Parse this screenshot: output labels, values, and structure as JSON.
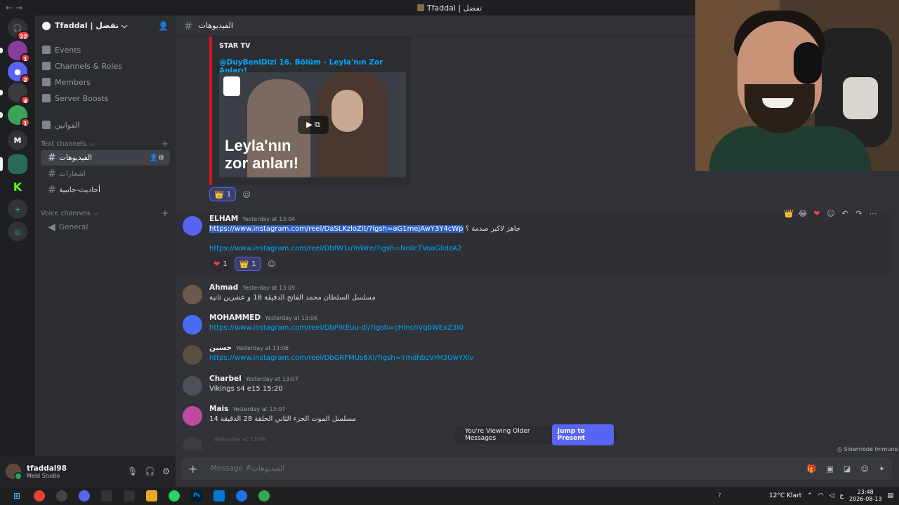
{
  "window": {
    "title": "Tfaddal | تفضل",
    "nav": "← →"
  },
  "server": {
    "name": "Tfaddal | تفضل ⌵",
    "menu": [
      "Events",
      "Channels & Roles",
      "Members",
      "Server Boosts",
      "القوانين"
    ],
    "text_category": "Text channels",
    "text_channels": [
      "الفيديوهات",
      "اشعارات",
      "أحاديث-جانبية"
    ],
    "voice_category": "Voice channels",
    "voice_channels": [
      "General"
    ]
  },
  "server_rail": {
    "badges": [
      "22",
      "1",
      "2",
      "4",
      "1"
    ],
    "letter": "M"
  },
  "header": {
    "channel": "الفيديوهات"
  },
  "embed": {
    "provider": "STAR TV",
    "title": "@DuyBeniDizi 16. Bölüm - Leyla'nın Zor Anları!",
    "caption_line1": "Leyla'nın",
    "caption_line2": "zor anları!",
    "reactions": [
      {
        "emoji": "👑",
        "count": "1"
      }
    ]
  },
  "messages": [
    {
      "author": "ELHAM",
      "time": "Yesterday at 13:04",
      "link1": "https://www.instagram.com/reel/DaSLKzloZit/?igsh=aG1mejAwY3Y4cWp",
      "text1": "جاهز لاكبر صدمة ؟",
      "link2": "https://www.instagram.com/reel/DbfW1uYoWre/?igsh=NnlicTVoaGlidzA2",
      "reactions": [
        {
          "emoji": "❤",
          "count": "1"
        },
        {
          "emoji": "👑",
          "count": "1"
        }
      ],
      "avatar_color": "#5865f2"
    },
    {
      "author": "Ahmad",
      "time": "Yesterday at 13:05",
      "text": "مسلسل السلطان محمد الفاتح الدقيقة 18 و عشرين ثانية",
      "avatar_color": "#6b5a4a"
    },
    {
      "author": "MOHAMMED",
      "time": "Yesterday at 13:06",
      "link": "https://www.instagram.com/reel/DbP9tEuu-dl/?igsh=cHlncnVqbWExZ3I0",
      "avatar_color": "#4a6cf2"
    },
    {
      "author": "حسين",
      "time": "Yesterday at 13:06",
      "link": "https://www.instagram.com/reel/DbGRFMUs6XI/?igsh=YmdhbzVrM3UwYXlv",
      "avatar_color": "#5a5040"
    },
    {
      "author": "Charbel",
      "time": "Yesterday at 13:07",
      "text": "Vikings s4 e15 15:20",
      "avatar_color": "#4e5058"
    },
    {
      "author": "Mais",
      "time": "Yesterday at 13:07",
      "text": "مسلسل الموت الجزء الثاني الحلقة 28 الدقيقة 14",
      "avatar_color": "#c04aa0"
    },
    {
      "author": "",
      "time": "Yesterday at 13:09",
      "avatar_color": "#4e5058"
    }
  ],
  "toolbar_icons": [
    "crown-icon",
    "laugh-icon",
    "heart-icon",
    "add-reaction-icon",
    "reply-icon",
    "forward-icon",
    "more-icon"
  ],
  "older_banner": {
    "text": "You're Viewing Older Messages",
    "button": "Jump to Present"
  },
  "slowmode": "Slowmode Immune",
  "composer": {
    "placeholder": "Message #الفيديوهات"
  },
  "user": {
    "name": "tfaddal98",
    "status": "Meld Studio"
  },
  "taskbar": {
    "weather": "12°C  Klart",
    "lang": "ع",
    "time": "23:48",
    "date": "2026-08-13"
  },
  "colors": {
    "accent": "#5865f2",
    "link": "#00a8fc",
    "embed_border": "#d4161e"
  }
}
